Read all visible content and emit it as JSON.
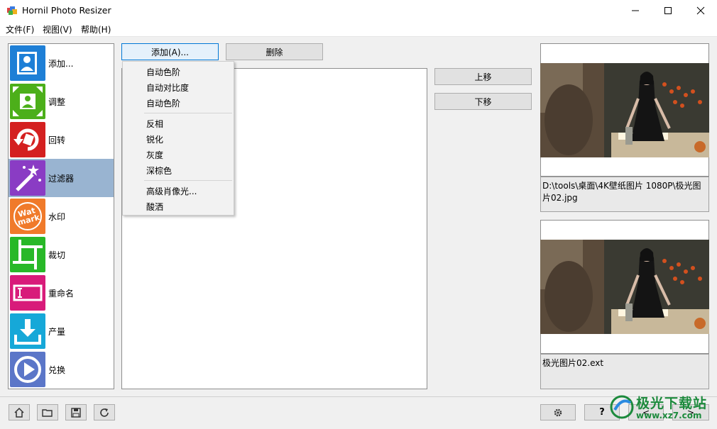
{
  "window": {
    "title": "Hornil Photo Resizer"
  },
  "menu": [
    "文件(F)",
    "视图(V)",
    "帮助(H)"
  ],
  "sidebar": {
    "items": [
      {
        "label": "添加...",
        "icon": "add-photo-icon",
        "color": "#1e7fd6",
        "active": false
      },
      {
        "label": "调整",
        "icon": "resize-icon",
        "color": "#4caf1a",
        "active": false
      },
      {
        "label": "回转",
        "icon": "rotate-icon",
        "color": "#d42020",
        "active": false
      },
      {
        "label": "过滤器",
        "icon": "filter-wand-icon",
        "color": "#8a3cc4",
        "active": true
      },
      {
        "label": "水印",
        "icon": "watermark-icon",
        "color": "#f07a2a",
        "active": false
      },
      {
        "label": "裁切",
        "icon": "crop-icon",
        "color": "#28b828",
        "active": false
      },
      {
        "label": "重命名",
        "icon": "rename-icon",
        "color": "#d81b7a",
        "active": false
      },
      {
        "label": "产量",
        "icon": "output-download-icon",
        "color": "#16a8d8",
        "active": false
      },
      {
        "label": "兑换",
        "icon": "convert-play-icon",
        "color": "#5b76c8",
        "active": false
      }
    ]
  },
  "toolbar": {
    "add_label": "添加(A)...",
    "delete_label": "删除",
    "up_label": "上移",
    "down_label": "下移"
  },
  "filter_menu": {
    "groups": [
      [
        "自动色阶",
        "自动对比度",
        "自动色阶"
      ],
      [
        "反相",
        "锐化",
        "灰度",
        "深棕色"
      ],
      [
        "高级肖像光...",
        "酸洒"
      ]
    ]
  },
  "preview": {
    "source_caption": "D:\\tools\\桌面\\4K壁纸图片 1080P\\极光图片02.jpg",
    "output_caption": "极光图片02.ext"
  },
  "bottom": {
    "help_label": "?",
    "prev_label": "<",
    "next_label": ">"
  },
  "watermark": {
    "name": "极光下载站",
    "url": "www.xz7.com"
  }
}
